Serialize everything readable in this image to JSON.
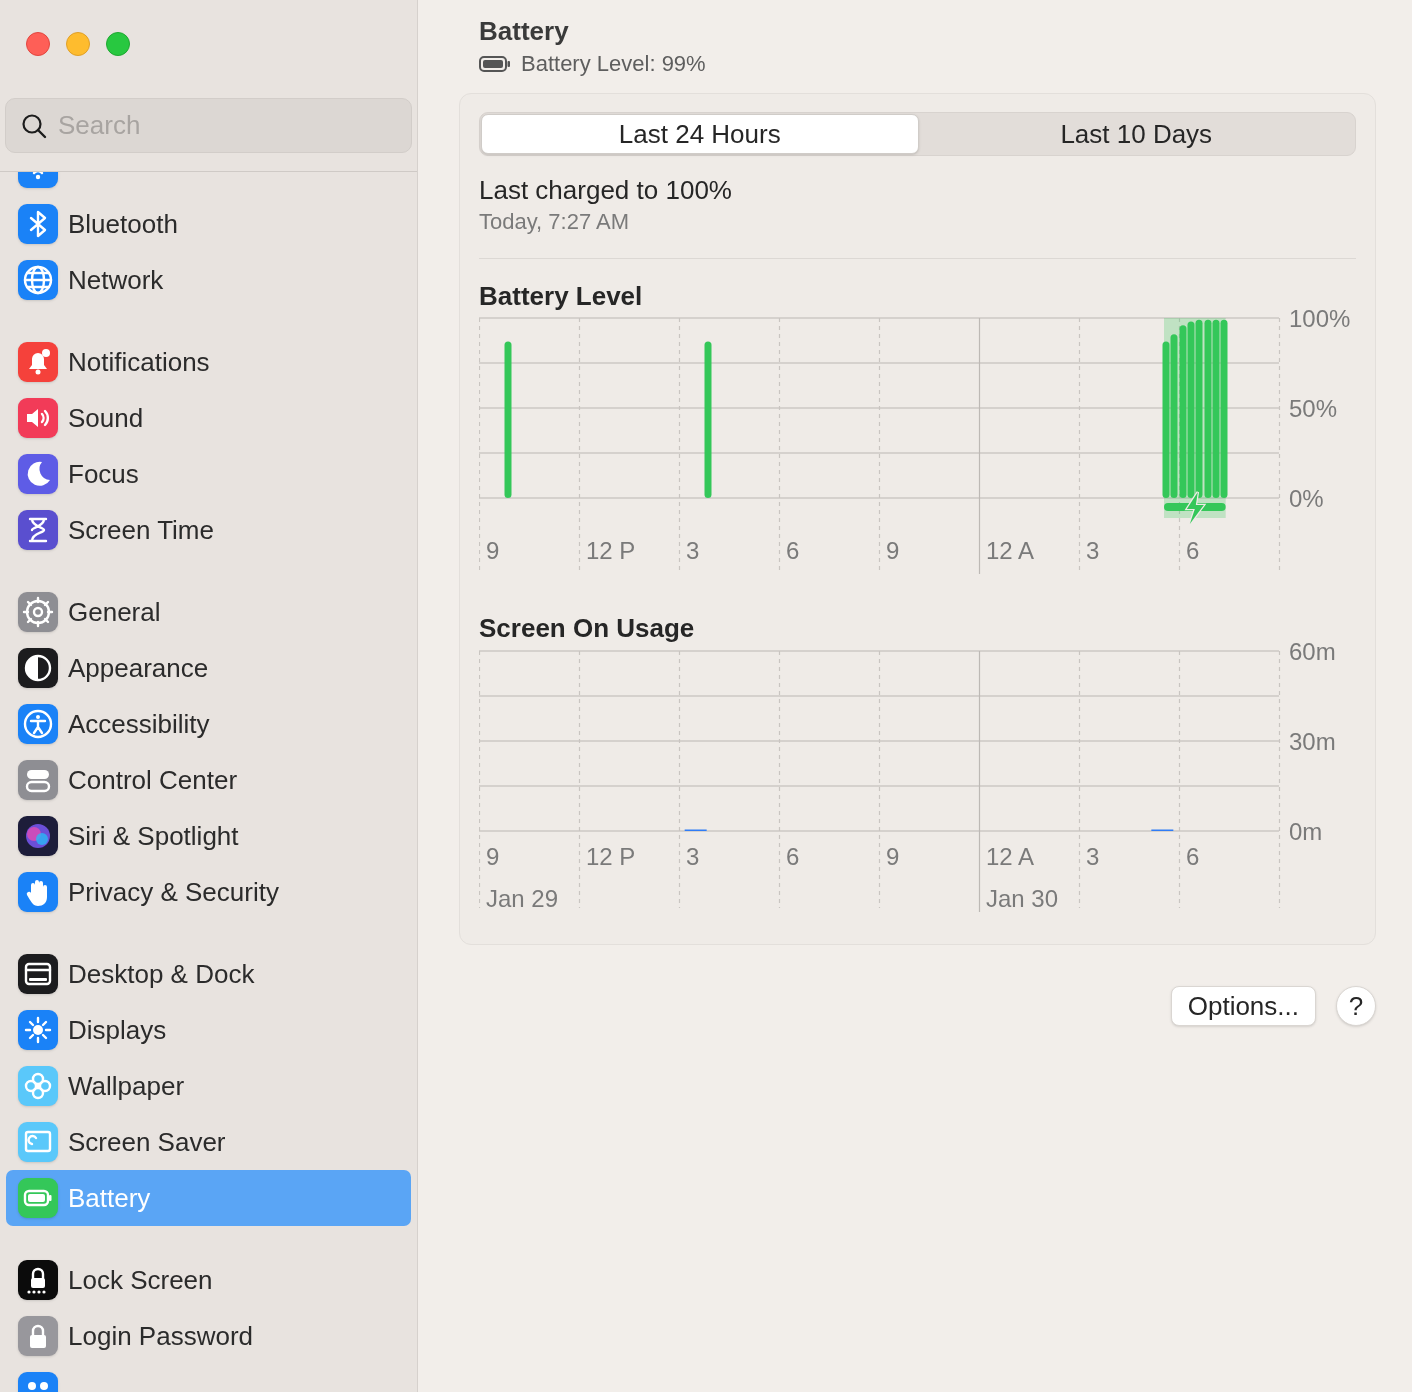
{
  "sidebar": {
    "search": {
      "placeholder": "Search"
    },
    "groups": [
      {
        "items": [
          {
            "selected": false
          },
          {
            "label": "Bluetooth",
            "selected": false
          },
          {
            "label": "Network",
            "selected": false
          }
        ]
      },
      {
        "items": [
          {
            "label": "Notifications",
            "selected": false
          },
          {
            "label": "Sound",
            "selected": false
          },
          {
            "label": "Focus",
            "selected": false
          },
          {
            "label": "Screen Time",
            "selected": false
          }
        ]
      },
      {
        "items": [
          {
            "label": "General",
            "selected": false
          },
          {
            "label": "Appearance",
            "selected": false
          },
          {
            "label": "Accessibility",
            "selected": false
          },
          {
            "label": "Control Center",
            "selected": false
          },
          {
            "label": "Siri & Spotlight",
            "selected": false
          },
          {
            "label": "Privacy & Security",
            "selected": false
          }
        ]
      },
      {
        "items": [
          {
            "label": "Desktop & Dock",
            "selected": false
          },
          {
            "label": "Displays",
            "selected": false
          },
          {
            "label": "Wallpaper",
            "selected": false
          },
          {
            "label": "Screen Saver",
            "selected": false
          },
          {
            "label": "Battery",
            "selected": true
          }
        ]
      },
      {
        "items": [
          {
            "label": "Lock Screen",
            "selected": false
          },
          {
            "label": "Login Password",
            "selected": false
          },
          {
            "selected": false
          }
        ]
      }
    ]
  },
  "header": {
    "title": "Battery",
    "subtitle": "Battery Level: 99%"
  },
  "tabs": [
    {
      "label": "Last 24 Hours",
      "selected": true
    },
    {
      "label": "Last 10 Days",
      "selected": false
    }
  ],
  "last_charged": {
    "title": "Last charged to 100%",
    "time": "Today, 7:27 AM"
  },
  "battery_level": {
    "title": "Battery Level",
    "x_labels": [
      "9",
      "12 P",
      "3",
      "6",
      "9",
      "12 A",
      "3",
      "6"
    ],
    "y_labels": [
      "100%",
      "50%",
      "0%"
    ]
  },
  "screen_usage": {
    "title": "Screen On Usage",
    "x_labels": [
      "9",
      "12 P",
      "3",
      "6",
      "9",
      "12 A",
      "3",
      "6"
    ],
    "y_labels": [
      "60m",
      "30m",
      "0m"
    ],
    "dates": [
      "Jan 29",
      "Jan 30"
    ]
  },
  "buttons": {
    "options": "Options...",
    "help": "?"
  }
}
